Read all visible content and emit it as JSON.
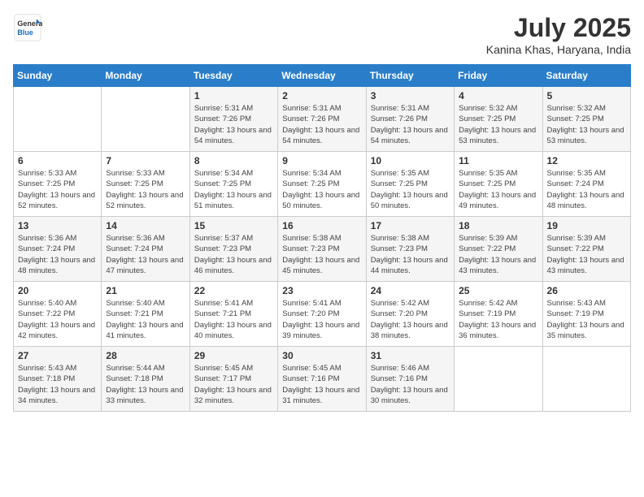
{
  "header": {
    "logo_general": "General",
    "logo_blue": "Blue",
    "title": "July 2025",
    "location": "Kanina Khas, Haryana, India"
  },
  "days_of_week": [
    "Sunday",
    "Monday",
    "Tuesday",
    "Wednesday",
    "Thursday",
    "Friday",
    "Saturday"
  ],
  "weeks": [
    [
      {
        "day": "",
        "info": ""
      },
      {
        "day": "",
        "info": ""
      },
      {
        "day": "1",
        "info": "Sunrise: 5:31 AM\nSunset: 7:26 PM\nDaylight: 13 hours and 54 minutes."
      },
      {
        "day": "2",
        "info": "Sunrise: 5:31 AM\nSunset: 7:26 PM\nDaylight: 13 hours and 54 minutes."
      },
      {
        "day": "3",
        "info": "Sunrise: 5:31 AM\nSunset: 7:26 PM\nDaylight: 13 hours and 54 minutes."
      },
      {
        "day": "4",
        "info": "Sunrise: 5:32 AM\nSunset: 7:25 PM\nDaylight: 13 hours and 53 minutes."
      },
      {
        "day": "5",
        "info": "Sunrise: 5:32 AM\nSunset: 7:25 PM\nDaylight: 13 hours and 53 minutes."
      }
    ],
    [
      {
        "day": "6",
        "info": "Sunrise: 5:33 AM\nSunset: 7:25 PM\nDaylight: 13 hours and 52 minutes."
      },
      {
        "day": "7",
        "info": "Sunrise: 5:33 AM\nSunset: 7:25 PM\nDaylight: 13 hours and 52 minutes."
      },
      {
        "day": "8",
        "info": "Sunrise: 5:34 AM\nSunset: 7:25 PM\nDaylight: 13 hours and 51 minutes."
      },
      {
        "day": "9",
        "info": "Sunrise: 5:34 AM\nSunset: 7:25 PM\nDaylight: 13 hours and 50 minutes."
      },
      {
        "day": "10",
        "info": "Sunrise: 5:35 AM\nSunset: 7:25 PM\nDaylight: 13 hours and 50 minutes."
      },
      {
        "day": "11",
        "info": "Sunrise: 5:35 AM\nSunset: 7:25 PM\nDaylight: 13 hours and 49 minutes."
      },
      {
        "day": "12",
        "info": "Sunrise: 5:35 AM\nSunset: 7:24 PM\nDaylight: 13 hours and 48 minutes."
      }
    ],
    [
      {
        "day": "13",
        "info": "Sunrise: 5:36 AM\nSunset: 7:24 PM\nDaylight: 13 hours and 48 minutes."
      },
      {
        "day": "14",
        "info": "Sunrise: 5:36 AM\nSunset: 7:24 PM\nDaylight: 13 hours and 47 minutes."
      },
      {
        "day": "15",
        "info": "Sunrise: 5:37 AM\nSunset: 7:23 PM\nDaylight: 13 hours and 46 minutes."
      },
      {
        "day": "16",
        "info": "Sunrise: 5:38 AM\nSunset: 7:23 PM\nDaylight: 13 hours and 45 minutes."
      },
      {
        "day": "17",
        "info": "Sunrise: 5:38 AM\nSunset: 7:23 PM\nDaylight: 13 hours and 44 minutes."
      },
      {
        "day": "18",
        "info": "Sunrise: 5:39 AM\nSunset: 7:22 PM\nDaylight: 13 hours and 43 minutes."
      },
      {
        "day": "19",
        "info": "Sunrise: 5:39 AM\nSunset: 7:22 PM\nDaylight: 13 hours and 43 minutes."
      }
    ],
    [
      {
        "day": "20",
        "info": "Sunrise: 5:40 AM\nSunset: 7:22 PM\nDaylight: 13 hours and 42 minutes."
      },
      {
        "day": "21",
        "info": "Sunrise: 5:40 AM\nSunset: 7:21 PM\nDaylight: 13 hours and 41 minutes."
      },
      {
        "day": "22",
        "info": "Sunrise: 5:41 AM\nSunset: 7:21 PM\nDaylight: 13 hours and 40 minutes."
      },
      {
        "day": "23",
        "info": "Sunrise: 5:41 AM\nSunset: 7:20 PM\nDaylight: 13 hours and 39 minutes."
      },
      {
        "day": "24",
        "info": "Sunrise: 5:42 AM\nSunset: 7:20 PM\nDaylight: 13 hours and 38 minutes."
      },
      {
        "day": "25",
        "info": "Sunrise: 5:42 AM\nSunset: 7:19 PM\nDaylight: 13 hours and 36 minutes."
      },
      {
        "day": "26",
        "info": "Sunrise: 5:43 AM\nSunset: 7:19 PM\nDaylight: 13 hours and 35 minutes."
      }
    ],
    [
      {
        "day": "27",
        "info": "Sunrise: 5:43 AM\nSunset: 7:18 PM\nDaylight: 13 hours and 34 minutes."
      },
      {
        "day": "28",
        "info": "Sunrise: 5:44 AM\nSunset: 7:18 PM\nDaylight: 13 hours and 33 minutes."
      },
      {
        "day": "29",
        "info": "Sunrise: 5:45 AM\nSunset: 7:17 PM\nDaylight: 13 hours and 32 minutes."
      },
      {
        "day": "30",
        "info": "Sunrise: 5:45 AM\nSunset: 7:16 PM\nDaylight: 13 hours and 31 minutes."
      },
      {
        "day": "31",
        "info": "Sunrise: 5:46 AM\nSunset: 7:16 PM\nDaylight: 13 hours and 30 minutes."
      },
      {
        "day": "",
        "info": ""
      },
      {
        "day": "",
        "info": ""
      }
    ]
  ]
}
